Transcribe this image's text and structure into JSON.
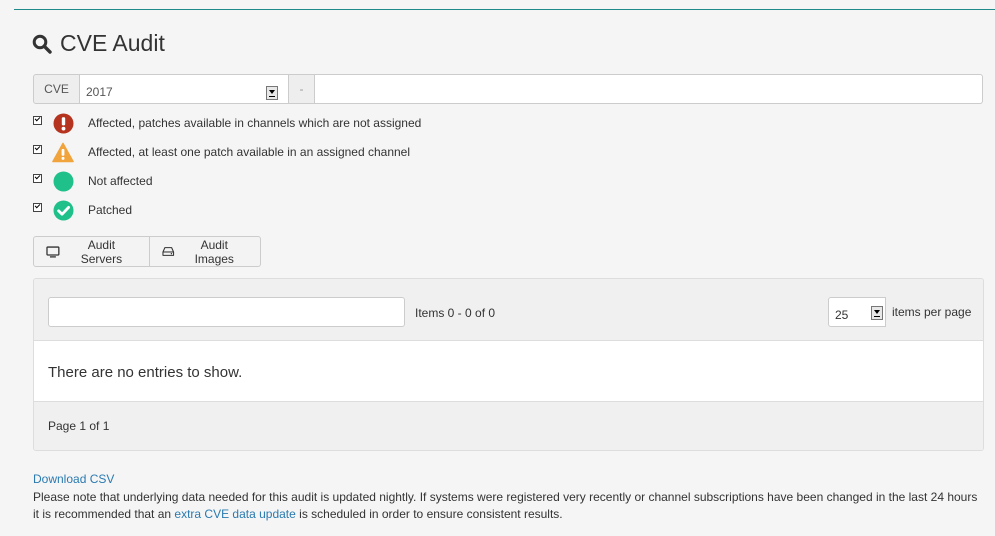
{
  "page": {
    "title": "CVE Audit"
  },
  "cve_form": {
    "prefix": "CVE",
    "year": "2017",
    "separator": "-",
    "number_value": ""
  },
  "filters": [
    {
      "label": "Affected, patches available in channels which are not assigned",
      "checked": true,
      "icon": "critical-exclamation-icon",
      "color": "#b5341f"
    },
    {
      "label": "Affected, at least one patch available in an assigned channel",
      "checked": true,
      "icon": "warning-triangle-icon",
      "color": "#f1a33c"
    },
    {
      "label": "Not affected",
      "checked": true,
      "icon": "not-affected-dot-icon",
      "color": "#20c08a"
    },
    {
      "label": "Patched",
      "checked": true,
      "icon": "patched-check-icon",
      "color": "#20c08a"
    }
  ],
  "buttons": {
    "audit_servers": "Audit Servers",
    "audit_images": "Audit Images"
  },
  "table": {
    "filter_value": "",
    "items_count": "Items 0 - 0 of 0",
    "per_page": "25",
    "per_page_label": "items per page",
    "empty_message": "There are no entries to show.",
    "pagination": "Page 1 of 1"
  },
  "footer": {
    "download_csv": "Download CSV",
    "note_before": "Please note that underlying data needed for this audit is updated nightly. If systems were registered very recently or channel subscriptions have been changed in the last 24 hours it is recommended that an ",
    "note_link": "extra CVE data update",
    "note_after": " is scheduled in order to ensure consistent results."
  },
  "colors": {
    "accent_rule": "#1f8a8a",
    "link": "#2a7ab0"
  }
}
